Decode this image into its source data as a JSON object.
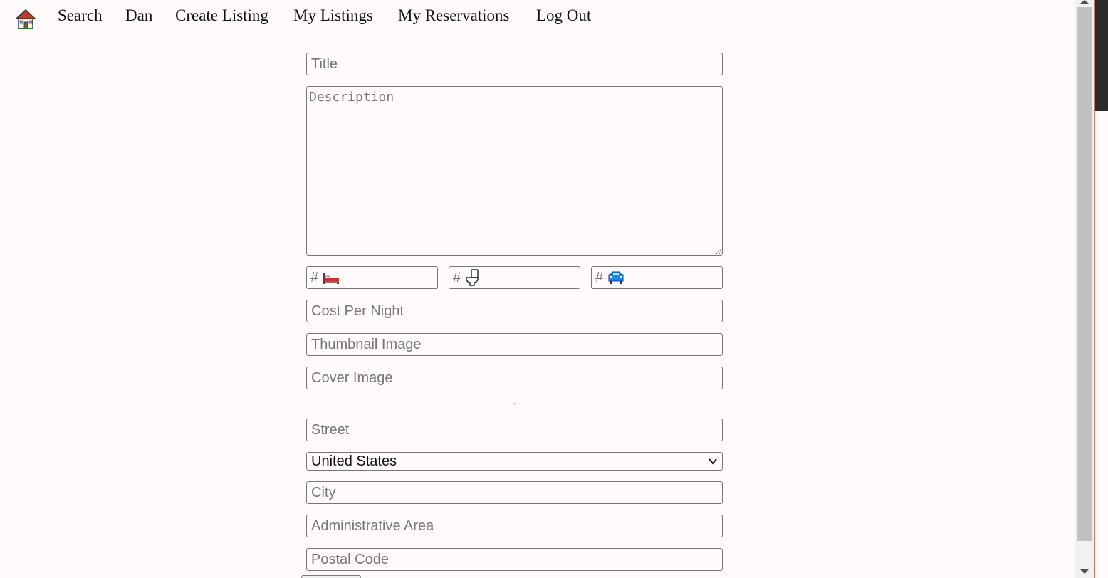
{
  "nav": {
    "home_icon": "house-icon",
    "items": [
      "Search",
      "Dan",
      "Create Listing",
      "My Listings",
      "My Reservations",
      "Log Out"
    ]
  },
  "form": {
    "title_placeholder": "Title",
    "description_placeholder": "Description",
    "bedrooms_prefix": "#",
    "bedrooms_icon": "bed-icon",
    "bathrooms_prefix": "#",
    "bathrooms_icon": "toilet-icon",
    "parking_prefix": "#",
    "parking_icon": "car-icon",
    "cost_placeholder": "Cost Per Night",
    "thumbnail_placeholder": "Thumbnail Image",
    "cover_placeholder": "Cover Image",
    "street_placeholder": "Street",
    "country_selected": "United States",
    "city_placeholder": "City",
    "admin_area_placeholder": "Administrative Area",
    "postal_code_placeholder": "Postal Code"
  }
}
